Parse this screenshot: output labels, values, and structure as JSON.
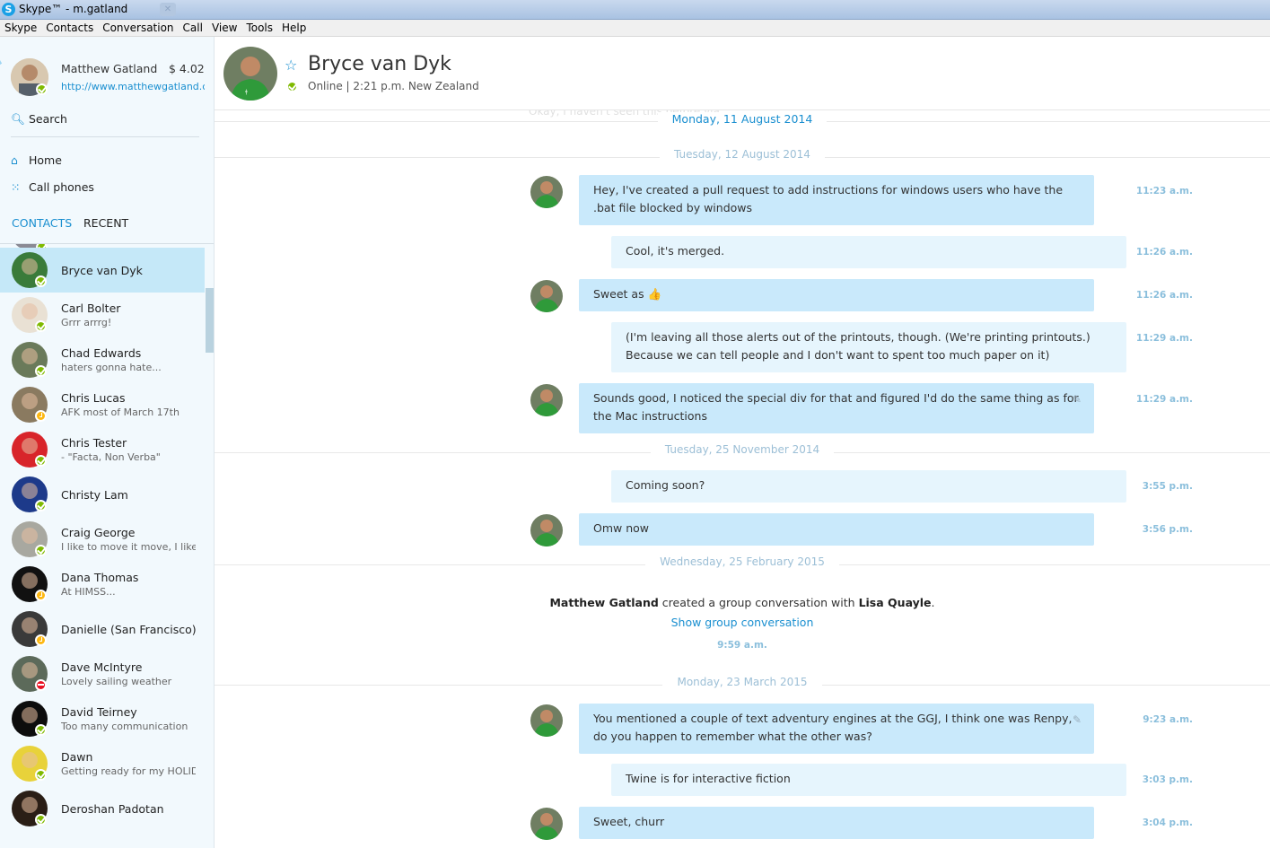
{
  "window": {
    "title": "Skype™ - m.gatland"
  },
  "menu": [
    "Skype",
    "Contacts",
    "Conversation",
    "Call",
    "View",
    "Tools",
    "Help"
  ],
  "profile": {
    "name": "Matthew Gatland",
    "credit": "$ 4.02",
    "url": "http://www.matthewgatland.com"
  },
  "sidebar": {
    "search_label": "Search",
    "home_label": "Home",
    "call_phones_label": "Call phones",
    "tab_contacts": "CONTACTS",
    "tab_recent": "RECENT"
  },
  "contacts": [
    {
      "name": "Bryce van Dyk",
      "mood": "",
      "status": "online",
      "selected": true,
      "avatar_color": "#3a7b3a"
    },
    {
      "name": "Carl Bolter",
      "mood": "Grrr arrrg!",
      "status": "online",
      "avatar_color": "#e9e1d4"
    },
    {
      "name": "Chad Edwards",
      "mood": "haters gonna hate...",
      "status": "online",
      "avatar_color": "#6a7a5a"
    },
    {
      "name": "Chris Lucas",
      "mood": "AFK most of March 17th",
      "status": "away",
      "avatar_color": "#8a7a60"
    },
    {
      "name": "Chris Tester",
      "mood": "- \"Facta, Non Verba\"",
      "status": "online",
      "avatar_color": "#d8242a"
    },
    {
      "name": "Christy Lam",
      "mood": "",
      "status": "online",
      "avatar_color": "#1d3a8a"
    },
    {
      "name": "Craig George",
      "mood": "I like to move it move, I like to",
      "status": "online",
      "avatar_color": "#a8a8a0"
    },
    {
      "name": "Dana Thomas",
      "mood": "At HIMSS...",
      "status": "away",
      "avatar_color": "#111111"
    },
    {
      "name": "Danielle (San Francisco)",
      "mood": "",
      "status": "away",
      "avatar_color": "#3a3a3a"
    },
    {
      "name": "Dave McIntyre",
      "mood": "Lovely sailing weather",
      "status": "dnd",
      "avatar_color": "#5c6a5a"
    },
    {
      "name": "David Teirney",
      "mood": "Too many communication",
      "status": "online",
      "avatar_color": "#0d0d0d"
    },
    {
      "name": "Dawn",
      "mood": "Getting ready for my HOLIDAY",
      "status": "online",
      "avatar_color": "#e8d23a"
    },
    {
      "name": "Deroshan Padotan",
      "mood": "",
      "status": "online",
      "avatar_color": "#2a1e16"
    }
  ],
  "conversation_header": {
    "name": "Bryce van Dyk",
    "status": "Online | 2:21 p.m. New Zealand"
  },
  "conversation": {
    "faded_top": "Okay, I haven't seen this before via...",
    "date_top": "Monday, 11 August 2014",
    "date_1": "Tuesday, 12 August 2014",
    "date_2": "Tuesday, 25 November 2014",
    "date_3": "Wednesday, 25 February 2015",
    "date_4": "Monday, 23 March 2015",
    "messages": [
      {
        "from": "them",
        "text": "Hey, I've created a pull request to add instructions for windows users who have the .bat file blocked by windows",
        "time": "11:23 a.m."
      },
      {
        "from": "me",
        "text": "Cool, it's merged.",
        "time": "11:26 a.m."
      },
      {
        "from": "them",
        "text": "Sweet as",
        "time": "11:26 a.m.",
        "emoticon": "👍"
      },
      {
        "from": "me",
        "text": "(I'm leaving all those alerts out of the printouts, though. (We're printing printouts.) Because we can tell people and I don't want to spent too much paper on it)",
        "time": "11:29 a.m."
      },
      {
        "from": "them",
        "text": "Sounds good, I noticed the special div for that and figured I'd do the same thing as for the Mac instructions",
        "time": "11:29 a.m.",
        "edited": true
      },
      {
        "from": "me",
        "text": "Coming soon?",
        "time": "3:55 p.m."
      },
      {
        "from": "them",
        "text": "Omw now",
        "time": "3:56 p.m."
      },
      {
        "from": "them",
        "text": "You mentioned a couple of text adventury engines at the GGJ, I think one was Renpy, do you happen to remember what the other was?",
        "time": "9:23 a.m.",
        "edited": true
      },
      {
        "from": "me",
        "text": "Twine is for interactive fiction",
        "time": "3:03 p.m."
      },
      {
        "from": "them",
        "text": "Sweet, churr",
        "time": "3:04 p.m."
      }
    ],
    "group_event": {
      "actor": "Matthew Gatland",
      "middle": "created a group conversation with",
      "target": "Lisa Quayle",
      "end": ".",
      "link": "Show group conversation",
      "time": "9:59 a.m."
    }
  }
}
